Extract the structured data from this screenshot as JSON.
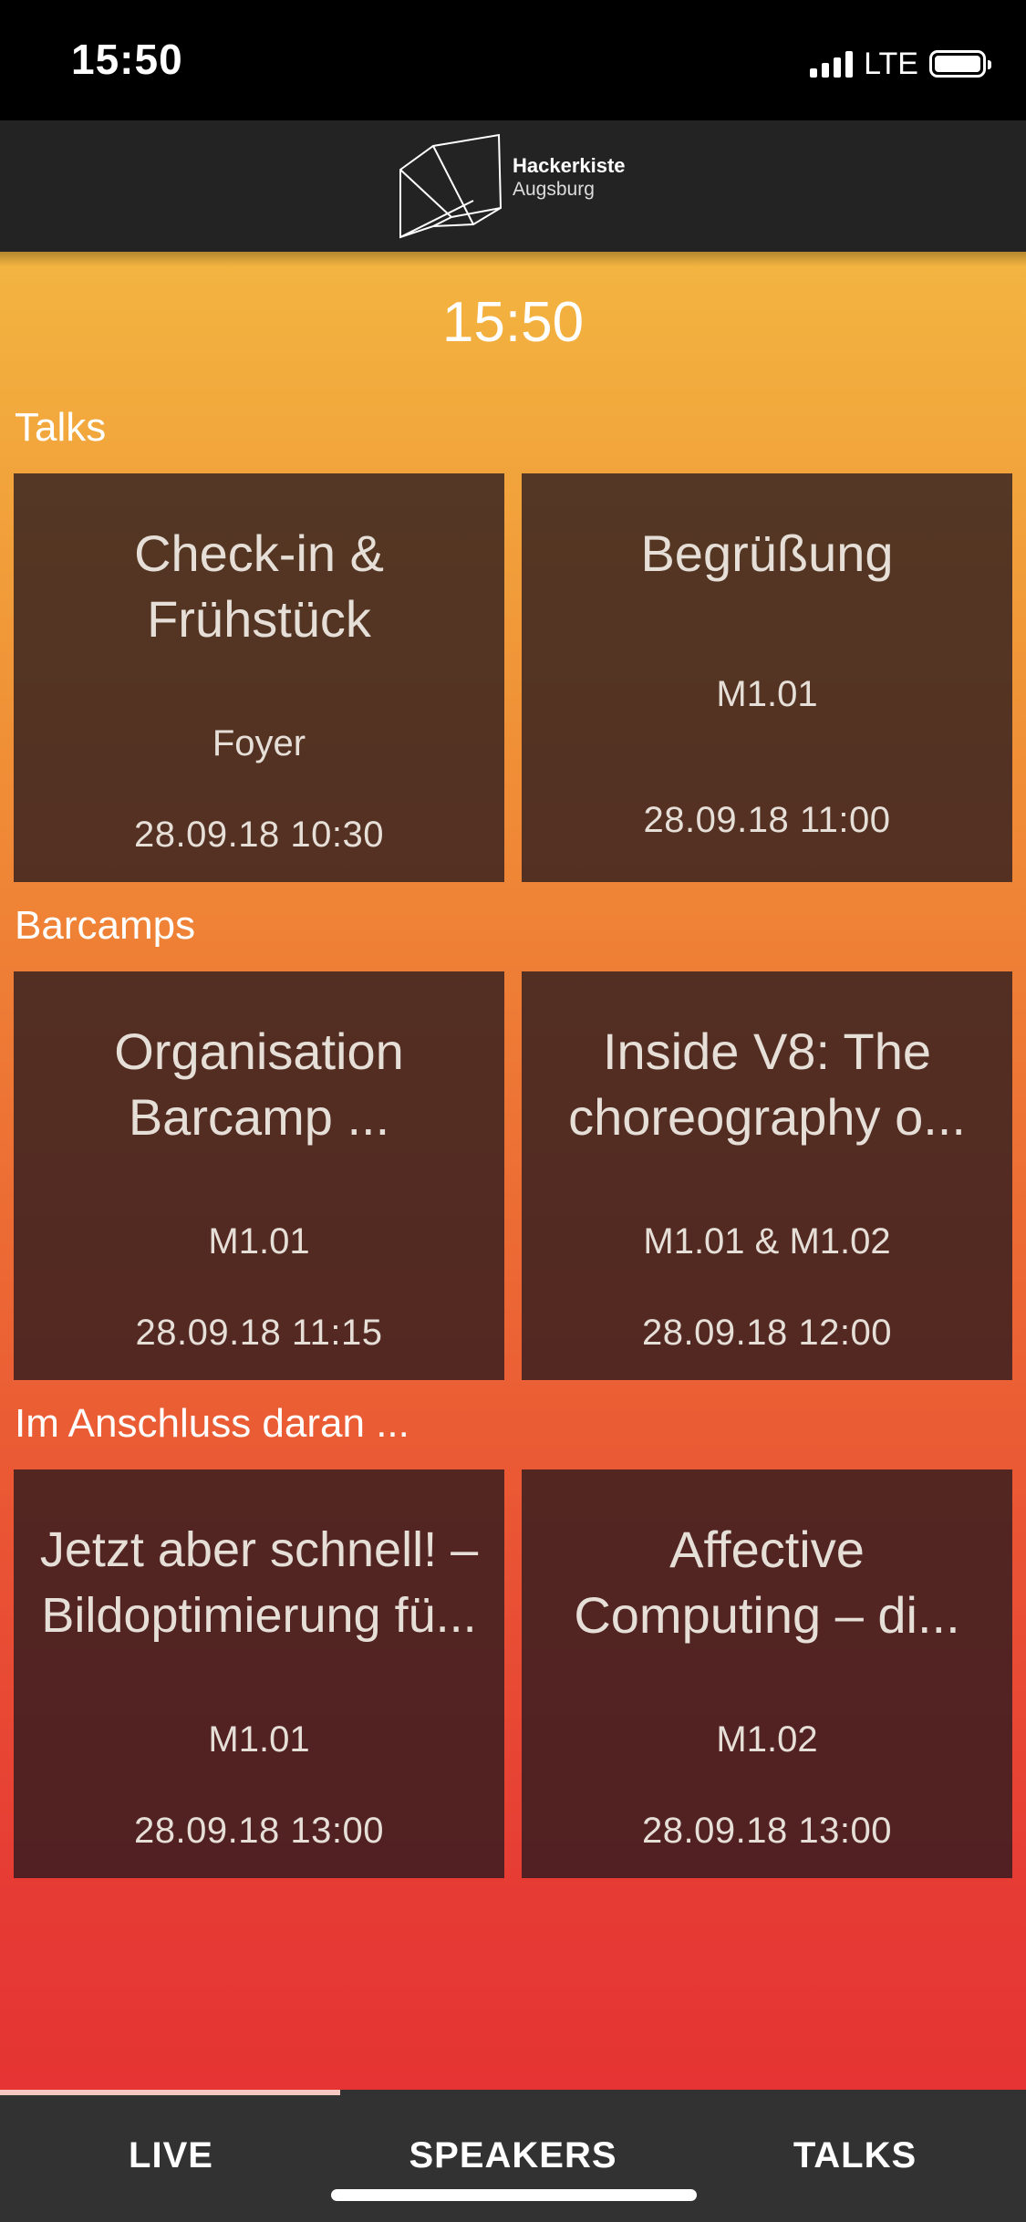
{
  "status_bar": {
    "time": "15:50",
    "network": "LTE"
  },
  "header": {
    "logo_line1": "Hackerkiste",
    "logo_line2": "Augsburg"
  },
  "current_time": "15:50",
  "sections": [
    {
      "title": "Talks",
      "cards": [
        {
          "title_lines": [
            "Check-in &",
            "Frühstück"
          ],
          "room": "Foyer",
          "datetime": "28.09.18 10:30"
        },
        {
          "title_lines": [
            "Begrüßung"
          ],
          "room": "M1.01",
          "datetime": "28.09.18 11:00"
        }
      ]
    },
    {
      "title": "Barcamps",
      "cards": [
        {
          "title_lines": [
            "Organisation",
            "Barcamp ..."
          ],
          "room": "M1.01",
          "datetime": "28.09.18 11:15"
        },
        {
          "title_lines": [
            "Inside V8: The",
            "choreography o..."
          ],
          "room": "M1.01 & M1.02",
          "datetime": "28.09.18 12:00"
        }
      ]
    },
    {
      "title": "Im Anschluss daran ...",
      "cards": [
        {
          "title_lines": [
            "Jetzt aber schnell! –",
            "Bildoptimierung fü..."
          ],
          "room": "M1.01",
          "datetime": "28.09.18 13:00"
        },
        {
          "title_lines": [
            "Affective",
            "Computing – di..."
          ],
          "room": "M1.02",
          "datetime": "28.09.18 13:00"
        }
      ]
    }
  ],
  "tabs": [
    {
      "label": "LIVE",
      "active": true
    },
    {
      "label": "SPEAKERS",
      "active": false
    },
    {
      "label": "TALKS",
      "active": false
    }
  ],
  "colors": {
    "gradient_top": "#f3b540",
    "gradient_bottom": "#e53433",
    "card_bg": "#3d2a25",
    "tab_bar": "#323232",
    "active_tab_indicator": "#f6c8c1"
  }
}
